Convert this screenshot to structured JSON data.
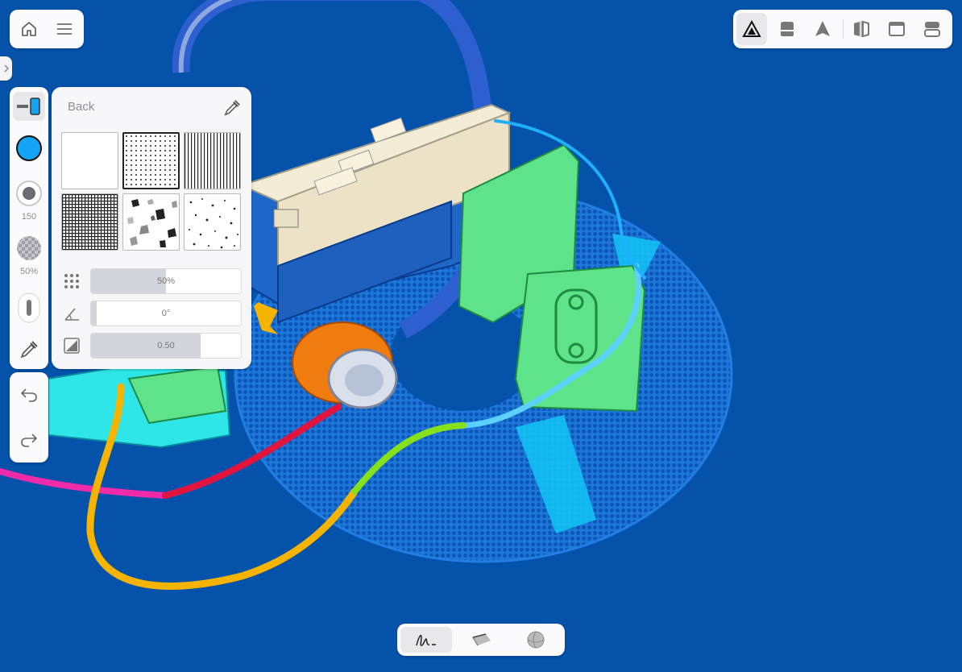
{
  "app": {
    "home_icon": "home-icon",
    "menu_icon": "hamburger-menu-icon"
  },
  "view_toolbar": {
    "items": [
      {
        "icon": "shaded-view-icon",
        "selected": true
      },
      {
        "icon": "silhouette-view-icon",
        "selected": false
      },
      {
        "icon": "flat-view-icon",
        "selected": false
      },
      {
        "icon": "split-view-icon",
        "selected": false
      },
      {
        "icon": "window-frame-icon",
        "selected": false
      },
      {
        "icon": "stacked-layout-icon",
        "selected": false
      }
    ]
  },
  "left_tools": {
    "brush_icon": "brush-preview-icon",
    "color": "#14a4f5",
    "size_label": "150",
    "opacity_label": "50%",
    "pencil_icon": "pencil-tool-icon",
    "eyedropper_icon": "eyedropper-icon"
  },
  "undo_panel": {
    "undo_icon": "undo-icon",
    "redo_icon": "redo-icon"
  },
  "texture_panel": {
    "back_label": "Back",
    "picker_icon": "eyedropper-icon",
    "textures": [
      {
        "name": "solid-white",
        "selected": false
      },
      {
        "name": "fine-dots",
        "selected": true
      },
      {
        "name": "vertical-lines",
        "selected": false
      },
      {
        "name": "grid-mesh",
        "selected": false
      },
      {
        "name": "terrazzo",
        "selected": false
      },
      {
        "name": "random-specks",
        "selected": false
      }
    ],
    "sliders": [
      {
        "icon": "density-dots-icon",
        "value_label": "50%",
        "fill": 0.5
      },
      {
        "icon": "angle-icon",
        "value_label": "0°",
        "fill": 0.04
      },
      {
        "icon": "contrast-icon",
        "value_label": "0.50",
        "fill": 0.73
      }
    ]
  },
  "bottom_toolbar": {
    "items": [
      {
        "icon": "freehand-draw-icon",
        "selected": true
      },
      {
        "icon": "eraser-tool-icon",
        "selected": false
      },
      {
        "icon": "sphere-icon",
        "selected": false
      }
    ]
  },
  "colors": {
    "background": "#0452aa",
    "accent": "#14a4f5",
    "cassette": "#5ee38a",
    "disc": "#2a8ae6",
    "cable_yellow": "#f6b400",
    "cable_red": "#e0143c",
    "cable_pink": "#f02aa8",
    "headphone_cup": "#f07c10"
  }
}
